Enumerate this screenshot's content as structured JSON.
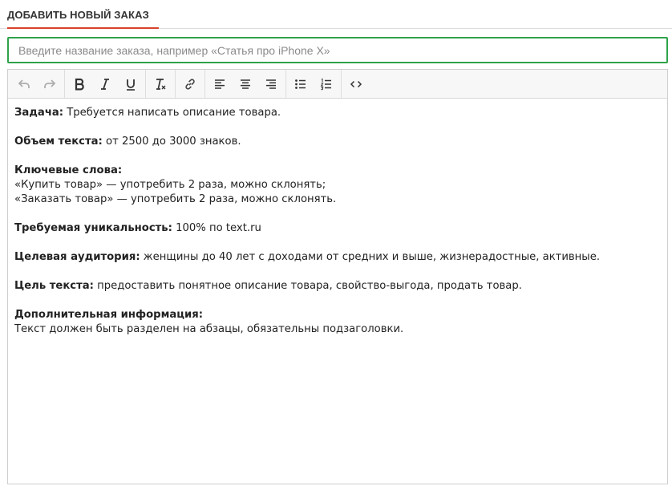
{
  "header": {
    "title": "ДОБАВИТЬ НОВЫЙ ЗАКАЗ"
  },
  "title_input": {
    "placeholder": "Введите название заказа, например «Статья про iPhone X»",
    "value": ""
  },
  "toolbar": {
    "groups": [
      [
        {
          "icon": "undo-icon"
        },
        {
          "icon": "redo-icon"
        }
      ],
      [
        {
          "icon": "bold-icon"
        },
        {
          "icon": "italic-icon"
        },
        {
          "icon": "underline-icon"
        }
      ],
      [
        {
          "icon": "clear-formatting-icon"
        }
      ],
      [
        {
          "icon": "link-icon"
        }
      ],
      [
        {
          "icon": "align-left-icon"
        },
        {
          "icon": "align-center-icon"
        },
        {
          "icon": "align-right-icon"
        }
      ],
      [
        {
          "icon": "bullet-list-icon"
        },
        {
          "icon": "numbered-list-icon"
        }
      ],
      [
        {
          "icon": "source-code-icon"
        }
      ]
    ]
  },
  "content": {
    "task": {
      "label": "Задача:",
      "text": " Требуется написать описание товара."
    },
    "volume": {
      "label": "Объем текста:",
      "text": " от 2500 до 3000 знаков."
    },
    "keywords": {
      "label": "Ключевые слова:",
      "line1": "«Купить товар» — употребить 2 раза, можно склонять;",
      "line2": "«Заказать товар» — употребить 2 раза, можно склонять."
    },
    "uniqueness": {
      "label": "Требуемая уникальность:",
      "text": " 100% по text.ru"
    },
    "audience": {
      "label": "Целевая аудитория:",
      "text": " женщины до 40 лет с доходами от средних и выше, жизнерадостные, активные."
    },
    "goal": {
      "label": "Цель текста:",
      "text": " предоставить понятное описание товара, свойство-выгода, продать товар."
    },
    "extra": {
      "label": "Дополнительная информация:",
      "line1": "Текст должен быть разделен на абзацы, обязательны подзаголовки."
    }
  }
}
